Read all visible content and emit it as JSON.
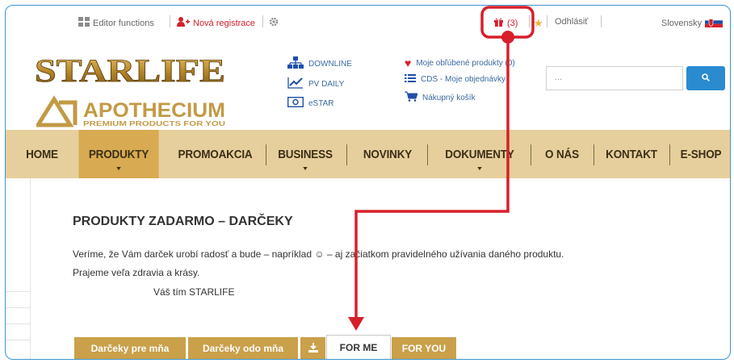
{
  "topbar": {
    "editor_label": "Editor functions",
    "register_label": "Nová registrace",
    "gift_count": "(3)",
    "logout_label": "Odhlásiť",
    "language_label": "Slovensky"
  },
  "logos": {
    "starlife_text": "STARLIFE",
    "apothecium_text": "APOTHECIUM",
    "apothecium_tagline": "PREMIUM PRODUCTS FOR YOU"
  },
  "quicklinks": {
    "downline": "DOWNLINE",
    "pv_daily": "PV DAILY",
    "estar": "eSTAR",
    "favorites": "Moje obľúbené produkty (0)",
    "cds": "CDS - Moje objednávky",
    "cart": "Nákupný košík"
  },
  "search": {
    "placeholder": "..."
  },
  "menu": {
    "items": [
      "HOME",
      "PRODUKTY",
      "PROMOAKCIA",
      "BUSINESS",
      "NOVINKY",
      "DOKUMENTY",
      "O NÁS",
      "KONTAKT",
      "E-SHOP"
    ],
    "active": "PRODUKTY"
  },
  "content": {
    "heading": "PRODUKTY ZADARMO – DARČEKY",
    "line1": "Veríme, že Vám darček urobí radosť a bude – napríklad ☺ – aj začiatkom pravidelného užívania daného produktu.",
    "line2": "Prajeme veľa zdravia a krásy.",
    "signature": "Váš tím STARLIFE"
  },
  "tabs": [
    "Darčeky pre mňa",
    "Darčeky odo mňa",
    "FOR ME",
    "FOR YOU"
  ],
  "colors": {
    "accent_blue": "#2a8bd0",
    "menu_bg": "#e6cf9c",
    "menu_active": "#d8aa51",
    "tab_gold": "#caa04a",
    "annotation_red": "#d6202a"
  }
}
